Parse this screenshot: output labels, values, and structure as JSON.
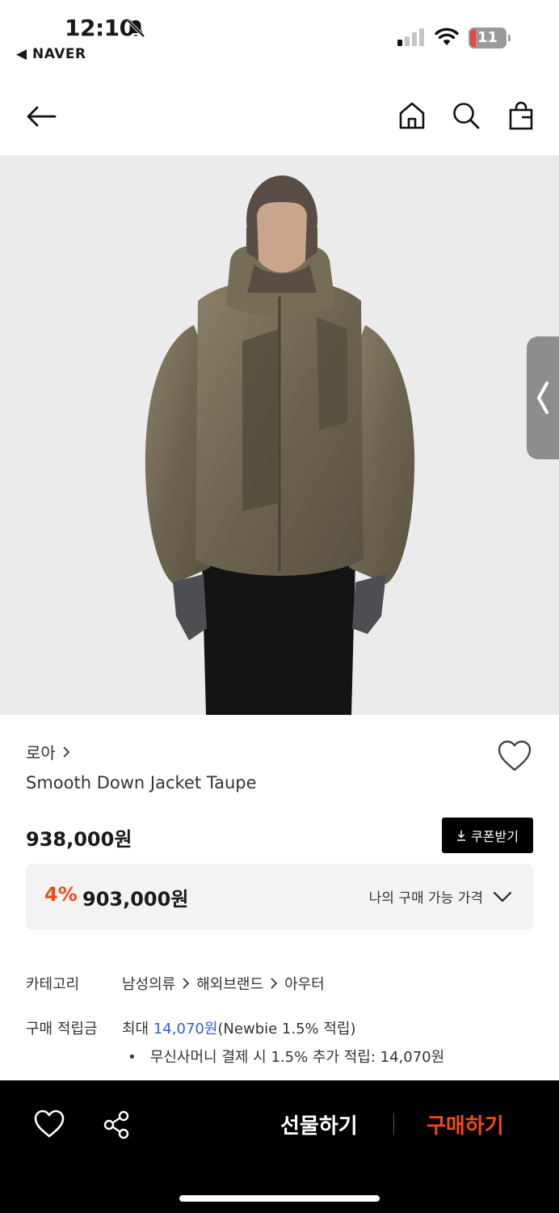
{
  "status_bar": {
    "time": "12:10",
    "back_app": "◀ NAVER",
    "battery": "11",
    "battery_color": "#e8463f"
  },
  "nav": {
    "back_icon": "arrow-left-icon",
    "home_icon": "home-icon",
    "search_icon": "search-icon",
    "bag_icon": "shopping-bag-icon"
  },
  "product": {
    "brand": "로아",
    "name": "Smooth Down Jacket Taupe",
    "price": "938,000원",
    "coupon_label": "쿠폰받기",
    "discount_rate": "4%",
    "sale_price": "903,000원",
    "my_price_label": "나의 구매 가능 가격"
  },
  "details": {
    "category_label": "카테고리",
    "category_path": [
      "남성의류",
      "해외브랜드",
      "아우터"
    ],
    "points_label": "구매 적립금",
    "points_prefix": "최대",
    "points_value": "14,070원",
    "points_suffix": "(Newbie 1.5% 적립)",
    "bullet_text": "무신사머니 결제 시 1.5% 추가 적립: 14,070원"
  },
  "bottom": {
    "gift_label": "선물하기",
    "buy_label": "구매하기",
    "accent": "#f04a1b"
  }
}
